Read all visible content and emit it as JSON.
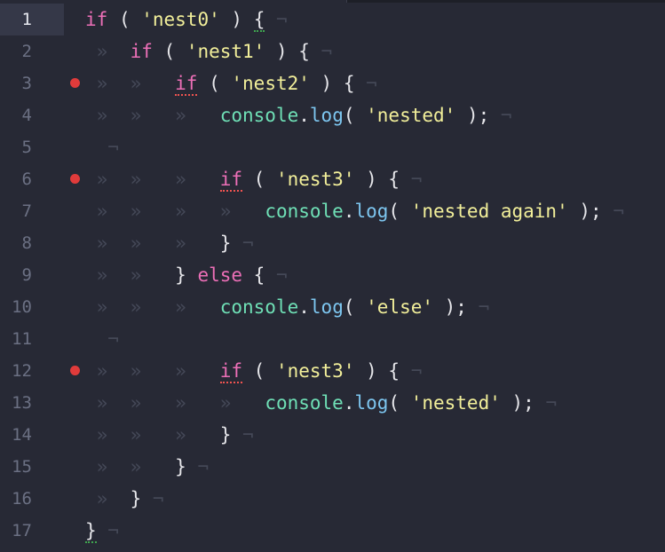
{
  "editor": {
    "active_line": 1,
    "breakpoint_lines": [
      3,
      6,
      12
    ],
    "colors": {
      "background": "#272935",
      "active_gutter": "#353848",
      "keyword": "#ec6fb7",
      "string": "#f2ef9a",
      "object": "#6fe0b6",
      "function": "#7dc6f0",
      "whitespace_marker": "#444857",
      "breakpoint": "#e03b3b"
    },
    "gutter_numbers": [
      "1",
      "2",
      "3",
      "4",
      "5",
      "6",
      "7",
      "8",
      "9",
      "10",
      "11",
      "12",
      "13",
      "14",
      "15",
      "16",
      "17"
    ],
    "lines": [
      {
        "indent": 0,
        "tokens": [
          {
            "t": "kw",
            "v": "if"
          },
          {
            "t": "pn",
            "v": " ( "
          },
          {
            "t": "str",
            "v": "'nest0'"
          },
          {
            "t": "pn",
            "v": " ) "
          },
          {
            "t": "pn",
            "v": "{",
            "u": "ug"
          },
          {
            "t": "ws",
            "v": " ¬"
          }
        ]
      },
      {
        "indent": 1,
        "tokens": [
          {
            "t": "kw",
            "v": "if"
          },
          {
            "t": "pn",
            "v": " ( "
          },
          {
            "t": "str",
            "v": "'nest1'"
          },
          {
            "t": "pn",
            "v": " ) {"
          },
          {
            "t": "ws",
            "v": " ¬"
          }
        ]
      },
      {
        "indent": 2,
        "tokens": [
          {
            "t": "kw",
            "v": "if",
            "u": "uw"
          },
          {
            "t": "pn",
            "v": " ( "
          },
          {
            "t": "str",
            "v": "'nest2'"
          },
          {
            "t": "pn",
            "v": " ) {"
          },
          {
            "t": "ws",
            "v": " ¬"
          }
        ]
      },
      {
        "indent": 3,
        "tokens": [
          {
            "t": "obj",
            "v": "console"
          },
          {
            "t": "pn",
            "v": "."
          },
          {
            "t": "fn",
            "v": "log"
          },
          {
            "t": "pn",
            "v": "( "
          },
          {
            "t": "str",
            "v": "'nested'"
          },
          {
            "t": "pn",
            "v": " );"
          },
          {
            "t": "ws",
            "v": " ¬"
          }
        ]
      },
      {
        "indent": 0,
        "tokens": [
          {
            "t": "ws",
            "v": "  ¬"
          }
        ]
      },
      {
        "indent": 3,
        "tokens": [
          {
            "t": "kw",
            "v": "if",
            "u": "uw"
          },
          {
            "t": "pn",
            "v": " ( "
          },
          {
            "t": "str",
            "v": "'nest3'"
          },
          {
            "t": "pn",
            "v": " ) {"
          },
          {
            "t": "ws",
            "v": " ¬"
          }
        ]
      },
      {
        "indent": 4,
        "tokens": [
          {
            "t": "obj",
            "v": "console"
          },
          {
            "t": "pn",
            "v": "."
          },
          {
            "t": "fn",
            "v": "log"
          },
          {
            "t": "pn",
            "v": "( "
          },
          {
            "t": "str",
            "v": "'nested again'"
          },
          {
            "t": "pn",
            "v": " );"
          },
          {
            "t": "ws",
            "v": " ¬"
          }
        ]
      },
      {
        "indent": 3,
        "tokens": [
          {
            "t": "pn",
            "v": "}"
          },
          {
            "t": "ws",
            "v": " ¬"
          }
        ]
      },
      {
        "indent": 2,
        "tokens": [
          {
            "t": "pn",
            "v": "} "
          },
          {
            "t": "kw",
            "v": "else"
          },
          {
            "t": "pn",
            "v": " {"
          },
          {
            "t": "ws",
            "v": " ¬"
          }
        ]
      },
      {
        "indent": 3,
        "tokens": [
          {
            "t": "obj",
            "v": "console"
          },
          {
            "t": "pn",
            "v": "."
          },
          {
            "t": "fn",
            "v": "log"
          },
          {
            "t": "pn",
            "v": "( "
          },
          {
            "t": "str",
            "v": "'else'"
          },
          {
            "t": "pn",
            "v": " );"
          },
          {
            "t": "ws",
            "v": " ¬"
          }
        ]
      },
      {
        "indent": 0,
        "tokens": [
          {
            "t": "ws",
            "v": "  ¬"
          }
        ]
      },
      {
        "indent": 3,
        "tokens": [
          {
            "t": "kw",
            "v": "if",
            "u": "uw"
          },
          {
            "t": "pn",
            "v": " ( "
          },
          {
            "t": "str",
            "v": "'nest3'"
          },
          {
            "t": "pn",
            "v": " ) {"
          },
          {
            "t": "ws",
            "v": " ¬"
          }
        ]
      },
      {
        "indent": 4,
        "tokens": [
          {
            "t": "obj",
            "v": "console"
          },
          {
            "t": "pn",
            "v": "."
          },
          {
            "t": "fn",
            "v": "log"
          },
          {
            "t": "pn",
            "v": "( "
          },
          {
            "t": "str",
            "v": "'nested'"
          },
          {
            "t": "pn",
            "v": " );"
          },
          {
            "t": "ws",
            "v": " ¬"
          }
        ]
      },
      {
        "indent": 3,
        "tokens": [
          {
            "t": "pn",
            "v": "}"
          },
          {
            "t": "ws",
            "v": " ¬"
          }
        ]
      },
      {
        "indent": 2,
        "tokens": [
          {
            "t": "pn",
            "v": "}"
          },
          {
            "t": "ws",
            "v": " ¬"
          }
        ]
      },
      {
        "indent": 1,
        "tokens": [
          {
            "t": "pn",
            "v": "}"
          },
          {
            "t": "ws",
            "v": " ¬"
          }
        ]
      },
      {
        "indent": 0,
        "tokens": [
          {
            "t": "pn",
            "v": "}",
            "u": "ug"
          },
          {
            "t": "ws",
            "v": " ¬"
          }
        ]
      }
    ]
  }
}
